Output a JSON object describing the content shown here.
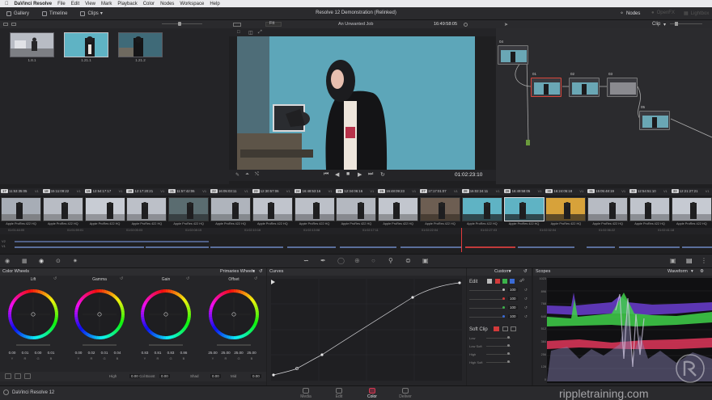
{
  "menubar": {
    "apple_icon": "apple-icon",
    "app_name": "DaVinci Resolve",
    "items": [
      "File",
      "Edit",
      "View",
      "Mark",
      "Playback",
      "Color",
      "Nodes",
      "Workspace",
      "Help"
    ]
  },
  "toolbar": {
    "gallery": "Gallery",
    "timeline": "Timeline",
    "clips": "Clips",
    "project_title": "Resolve 12 Demonstration (Relinked)",
    "nodes": "Nodes",
    "openfx": "OpenFX",
    "lightbox": "Lightbox"
  },
  "viewer": {
    "zoom": "Fit",
    "timeline_name": "An Unwanted Job",
    "timecode": "16:49:58:05",
    "playhead_timecode": "01:02:23:10",
    "node_mode": "Clip"
  },
  "gallery": {
    "stills": [
      {
        "label": "1.8.1"
      },
      {
        "label": "1.21.1"
      },
      {
        "label": "1.21.2"
      }
    ]
  },
  "nodes": {
    "items": [
      {
        "num": "04"
      },
      {
        "num": "01"
      },
      {
        "num": "02"
      },
      {
        "num": "03"
      },
      {
        "num": "05"
      }
    ]
  },
  "timeline": {
    "clips": [
      {
        "num": "17",
        "tc": "11:53:35:05",
        "track": "V1",
        "codec": "Apple ProRes 422 HQ"
      },
      {
        "num": "18",
        "tc": "15:11:09:22",
        "track": "V1",
        "codec": "Apple ProRes 422 HQ"
      },
      {
        "num": "19",
        "tc": "12:54:17:17",
        "track": "V1",
        "codec": "Apple ProRes 422 HQ"
      },
      {
        "num": "20",
        "tc": "12:17:20:21",
        "track": "V1",
        "codec": "Apple ProRes 422 HQ"
      },
      {
        "num": "21",
        "tc": "11:57:42:06",
        "track": "V1",
        "codec": "Apple ProRes 422 HQ"
      },
      {
        "num": "22",
        "tc": "16:05:03:11",
        "track": "V1",
        "codec": "Apple ProRes 422 HQ"
      },
      {
        "num": "23",
        "tc": "12:30:57:06",
        "track": "V1",
        "codec": "Apple ProRes 422 HQ"
      },
      {
        "num": "24",
        "tc": "16:48:53:16",
        "track": "V1",
        "codec": "Apple ProRes 422 HQ"
      },
      {
        "num": "25",
        "tc": "12:34:06:16",
        "track": "V1",
        "codec": "Apple ProRes 422 HQ"
      },
      {
        "num": "26",
        "tc": "16:48:09:23",
        "track": "V1",
        "codec": "Apple ProRes 422 HQ"
      },
      {
        "num": "27",
        "tc": "17:17:01:07",
        "track": "V1",
        "codec": "Apple ProRes 422 HQ"
      },
      {
        "num": "28",
        "tc": "16:02:24:11",
        "track": "V1",
        "codec": "Apple ProRes 422 HQ"
      },
      {
        "num": "29",
        "tc": "16:49:58:05",
        "track": "V1",
        "codec": "Apple ProRes 422 HQ"
      },
      {
        "num": "30",
        "tc": "16:24:05:18",
        "track": "V1",
        "codec": "Apple ProRes 422 HQ"
      },
      {
        "num": "31",
        "tc": "15:05:48:19",
        "track": "V1",
        "codec": "Apple ProRes 422 HQ"
      },
      {
        "num": "32",
        "tc": "12:54:51:10",
        "track": "V1",
        "codec": "Apple ProRes 422 HQ"
      },
      {
        "num": "33",
        "tc": "12:21:27:21",
        "track": "V1",
        "codec": "Apple ProRes 422 HQ"
      }
    ],
    "ruler": [
      "01:01:44:00",
      "01:01:59:01",
      "01:02:05:03",
      "01:02:08:15",
      "01:02:10:16",
      "01:02:13:08",
      "01:02:17:11",
      "01:02:22:04",
      "01:02:27:03",
      "01:02:32:04",
      "01:02:36:22",
      "01:02:41:18"
    ],
    "tracks": [
      "V2",
      "V1"
    ]
  },
  "color_wheels": {
    "title": "Color Wheels",
    "mode": "Primaries Wheels",
    "wheels": [
      {
        "name": "Lift",
        "values": [
          "0.00",
          "0.01",
          "0.00",
          "0.01"
        ]
      },
      {
        "name": "Gamma",
        "values": [
          "0.00",
          "0.02",
          "0.01",
          "0.04"
        ]
      },
      {
        "name": "Gain",
        "values": [
          "0.83",
          "0.81",
          "0.83",
          "0.86"
        ]
      },
      {
        "name": "Offset",
        "values": [
          "25.00",
          "25.00",
          "25.00",
          "25.00"
        ]
      }
    ],
    "channels": [
      "Y",
      "R",
      "G",
      "B"
    ],
    "footer": [
      {
        "label": "High",
        "value": "0.00"
      },
      {
        "label": "Col Boost",
        "value": "0.00"
      },
      {
        "label": "Shad",
        "value": "0.00"
      },
      {
        "label": "Mid",
        "value": "0.00"
      }
    ]
  },
  "curves": {
    "title": "Curves",
    "mode": "Custom",
    "edit_label": "Edit",
    "edit_values": [
      "100",
      "100",
      "100",
      "100"
    ],
    "soft_clip": "Soft Clip",
    "soft_clip_rows": [
      "Low",
      "Low Soft",
      "High",
      "High Soft"
    ]
  },
  "scopes": {
    "title": "Scopes",
    "mode": "Waveform",
    "scale": [
      "1023",
      "896",
      "768",
      "640",
      "512",
      "384",
      "256",
      "128",
      "0"
    ]
  },
  "bottom": {
    "app_version": "DaVinci Resolve 12",
    "tabs": [
      "Media",
      "Edit",
      "Color",
      "Deliver"
    ],
    "watermark": "rippletraining.com"
  }
}
